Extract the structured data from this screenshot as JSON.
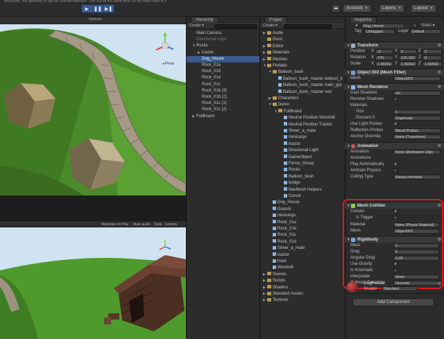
{
  "toolbar": {
    "title_fragment": "specifying   ·   the geometry to use for collision detection. This can be the same mesh as the Mesh Filter or a",
    "play": "▶",
    "pause": "❚❚",
    "step": "▶❚",
    "account": "Account",
    "layers": "Layers",
    "layout": "Layout",
    "cloud_icon": "cloud-icon"
  },
  "scene_view": {
    "gizmos_label": "Gizmos",
    "persp_label": "◂ Persp"
  },
  "game_view": {
    "maximize": "Maximize on Play",
    "mute": "Mute audio",
    "stats": "Stats",
    "gizmos": "Gizmos"
  },
  "hierarchy": {
    "tab": "Hierarchy",
    "create": "Create ▾",
    "items": [
      {
        "label": "Main Camera",
        "indent": 0,
        "tri": "",
        "state": ""
      },
      {
        "label": "Directional Light",
        "indent": 0,
        "tri": "",
        "state": "dim"
      },
      {
        "label": "Rocks",
        "indent": 0,
        "tri": "▼",
        "state": ""
      },
      {
        "label": "tractor",
        "indent": 1,
        "tri": "▶",
        "state": ""
      },
      {
        "label": "Dog_House",
        "indent": 1,
        "tri": "",
        "state": "sel"
      },
      {
        "label": "Rock_01a",
        "indent": 1,
        "tri": "",
        "state": ""
      },
      {
        "label": "Rock_01b",
        "indent": 1,
        "tri": "",
        "state": ""
      },
      {
        "label": "Rock_01d",
        "indent": 1,
        "tri": "",
        "state": ""
      },
      {
        "label": "Rock_01c",
        "indent": 1,
        "tri": "",
        "state": ""
      },
      {
        "label": "Rock_01b (3)",
        "indent": 1,
        "tri": "",
        "state": ""
      },
      {
        "label": "Rock_01b (2)",
        "indent": 1,
        "tri": "",
        "state": ""
      },
      {
        "label": "Rock_01c (1)",
        "indent": 1,
        "tri": "",
        "state": ""
      },
      {
        "label": "Rock_01c (2)",
        "indent": 1,
        "tri": "",
        "state": ""
      },
      {
        "label": "FullBoard",
        "indent": 0,
        "tri": "▶",
        "state": ""
      }
    ]
  },
  "project": {
    "tab": "Project",
    "create": "Create ▾",
    "items": [
      {
        "label": "Audio",
        "indent": 0,
        "kind": "folder",
        "tri": "▶"
      },
      {
        "label": "Doco",
        "indent": 0,
        "kind": "folder",
        "tri": ""
      },
      {
        "label": "Editor",
        "indent": 0,
        "kind": "folder",
        "tri": "▶"
      },
      {
        "label": "Materials",
        "indent": 0,
        "kind": "folder",
        "tri": "▶"
      },
      {
        "label": "Meshes",
        "indent": 0,
        "kind": "folder",
        "tri": "▶"
      },
      {
        "label": "Prefabs",
        "indent": 0,
        "kind": "folder",
        "tri": "▼"
      },
      {
        "label": "Balloon_bush",
        "indent": 1,
        "kind": "folder",
        "tri": "▼"
      },
      {
        "label": "Balloon_bush_master balloon_b",
        "indent": 2,
        "kind": "cube",
        "tri": ""
      },
      {
        "label": "Balloon_bush_master main_grp",
        "indent": 2,
        "kind": "cube",
        "tri": ""
      },
      {
        "label": "Balloon_bush_master root",
        "indent": 2,
        "kind": "cube",
        "tri": ""
      },
      {
        "label": "Characters",
        "indent": 1,
        "kind": "folder",
        "tri": "▶"
      },
      {
        "label": "Demo",
        "indent": 1,
        "kind": "folder",
        "tri": "▼"
      },
      {
        "label": "FullBoard",
        "indent": 2,
        "kind": "folder",
        "tri": "▼"
      },
      {
        "label": "Neutral Position Windmill",
        "indent": 3,
        "kind": "cube",
        "tri": ""
      },
      {
        "label": "Neutral Position Tractor",
        "indent": 3,
        "kind": "cube",
        "tri": ""
      },
      {
        "label": "Sheer_a_mate",
        "indent": 3,
        "kind": "cube",
        "tri": ""
      },
      {
        "label": "minicargo",
        "indent": 3,
        "kind": "cube",
        "tri": ""
      },
      {
        "label": "tractor",
        "indent": 3,
        "kind": "cube",
        "tri": ""
      },
      {
        "label": "Directional Light",
        "indent": 3,
        "kind": "cube",
        "tri": ""
      },
      {
        "label": "GameObject",
        "indent": 3,
        "kind": "cube",
        "tri": ""
      },
      {
        "label": "Fence_Group",
        "indent": 3,
        "kind": "cube",
        "tri": ""
      },
      {
        "label": "Rocks",
        "indent": 3,
        "kind": "cube",
        "tri": ""
      },
      {
        "label": "Balloon_bush",
        "indent": 3,
        "kind": "cube",
        "tri": ""
      },
      {
        "label": "bridge",
        "indent": 3,
        "kind": "cube",
        "tri": ""
      },
      {
        "label": "NavMesh Helpers",
        "indent": 3,
        "kind": "cube",
        "tri": ""
      },
      {
        "label": "Cursor",
        "indent": 3,
        "kind": "cube",
        "tri": ""
      },
      {
        "label": "Dog_House",
        "indent": 1,
        "kind": "cube",
        "tri": ""
      },
      {
        "label": "Grass5",
        "indent": 1,
        "kind": "cube",
        "tri": ""
      },
      {
        "label": "minicargo",
        "indent": 1,
        "kind": "cube",
        "tri": ""
      },
      {
        "label": "Rock_01a",
        "indent": 1,
        "kind": "cube",
        "tri": ""
      },
      {
        "label": "Rock_01b",
        "indent": 1,
        "kind": "cube",
        "tri": ""
      },
      {
        "label": "Rock_01c",
        "indent": 1,
        "kind": "cube",
        "tri": ""
      },
      {
        "label": "Rock_01d",
        "indent": 1,
        "kind": "cube",
        "tri": ""
      },
      {
        "label": "Sheer_a_mate",
        "indent": 1,
        "kind": "cube",
        "tri": ""
      },
      {
        "label": "tractor",
        "indent": 1,
        "kind": "cube",
        "tri": ""
      },
      {
        "label": "track",
        "indent": 1,
        "kind": "cube",
        "tri": ""
      },
      {
        "label": "Windmill",
        "indent": 1,
        "kind": "cube",
        "tri": ""
      },
      {
        "label": "Scenes",
        "indent": 0,
        "kind": "folder",
        "tri": "▶"
      },
      {
        "label": "Scripts",
        "indent": 0,
        "kind": "folder",
        "tri": "▶"
      },
      {
        "label": "Shaders",
        "indent": 0,
        "kind": "folder",
        "tri": "▶"
      },
      {
        "label": "Standard Assets",
        "indent": 0,
        "kind": "folder",
        "tri": "▶"
      },
      {
        "label": "Textures",
        "indent": 0,
        "kind": "folder",
        "tri": "▶"
      }
    ]
  },
  "inspector": {
    "tab": "Inspector",
    "object_name": "Dog_House",
    "static_label": "Static ▾",
    "tag_label": "Tag",
    "tag_value": "Untagged",
    "layer_label": "Layer",
    "layer_value": "Default",
    "transform": {
      "title": "Transform",
      "position_label": "Position",
      "pos_x": "-5",
      "pos_y": "0",
      "pos_z": "2",
      "rotation_label": "Rotation",
      "rot_x": "270",
      "rot_y": "125.332",
      "rot_z": "0",
      "scale_label": "Scale",
      "scale_x": "1.56562",
      "scale_y": "1.56562",
      "scale_z": "1.56562",
      "x": "X",
      "y": "Y",
      "z": "Z"
    },
    "mesh_filter": {
      "title": "Object 002 (Mesh Filter)",
      "mesh_label": "Mesh",
      "mesh_value": "Object002"
    },
    "mesh_renderer": {
      "title": "Mesh Renderer",
      "cast_label": "Cast Shadows",
      "cast_value": "On",
      "receive_label": "Receive Shadows",
      "materials_label": "Materials",
      "size_label": "Size",
      "size_value": "1",
      "element_label": "Element 0",
      "element_value": "Doghouse",
      "light_probes_label": "Use Light Probes",
      "reflection_label": "Reflection Probes",
      "reflection_value": "Blend Probes",
      "anchor_label": "Anchor Override",
      "anchor_value": "None (Transform)"
    },
    "animation": {
      "title": "Animation",
      "anim_label": "Animation",
      "anim_value": "None (Animation Clip)",
      "anims_label": "Animations",
      "play_label": "Play Automatically",
      "physics_label": "Animate Physics",
      "culling_label": "Culling Type",
      "culling_value": "Always Animate"
    },
    "mesh_collider": {
      "title": "Mesh Collider",
      "convex_label": "Convex",
      "trigger_label": "Is Trigger",
      "material_label": "Material",
      "material_value": "None (Physic Material)",
      "mesh_label": "Mesh",
      "mesh_value": "Object002"
    },
    "rigidbody": {
      "title": "Rigidbody",
      "mass_label": "Mass",
      "mass_value": "1",
      "drag_label": "Drag",
      "drag_value": "0",
      "angular_label": "Angular Drag",
      "angular_value": "0.05",
      "gravity_label": "Use Gravity",
      "kinematic_label": "Is Kinematic",
      "interp_label": "Interpolate",
      "interp_value": "None",
      "collision_label": "Collision Detection",
      "collision_value": "Discrete"
    },
    "material": {
      "name": "DogHouse",
      "shader_label": "Shader",
      "shader_value": "Standard"
    },
    "add_component": "Add Component",
    "check_mark": "✓",
    "gear": "⚙"
  }
}
